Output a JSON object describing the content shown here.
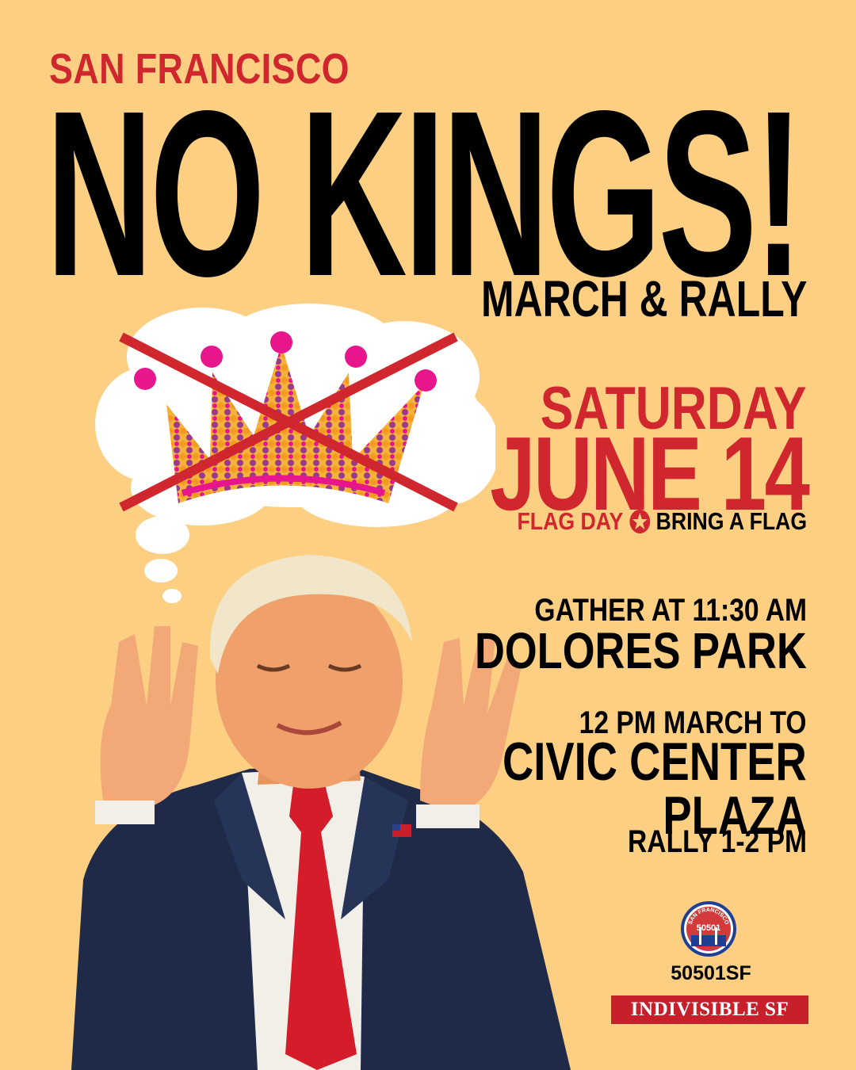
{
  "header": {
    "city": "SAN FRANCISCO",
    "headline": "NO KINGS!",
    "subhead": "MARCH & RALLY"
  },
  "date_block": {
    "day": "SATURDAY",
    "date": "JUNE 14",
    "flag_day": "FLAG DAY",
    "bring_flag": "BRING A FLAG"
  },
  "schedule": {
    "gather_time": "GATHER AT 11:30 AM",
    "gather_place": "DOLORES PARK",
    "march_time": "12 PM MARCH TO",
    "march_dest_line1": "CIVIC CENTER",
    "march_dest_line2": "PLAZA",
    "rally_time": "RALLY 1-2 PM"
  },
  "organizers": {
    "logo_top_text": "SAN FRANCISCO",
    "logo_number": "50501",
    "org_name": "50501SF",
    "badge": "INDIVISIBLE SF"
  },
  "icons": {
    "crown": "crown-icon",
    "cross": "cross-out-icon",
    "star": "star-icon",
    "logo": "50501-logo"
  },
  "colors": {
    "background": "#fccf83",
    "accent_red": "#d0262e",
    "crown_pink": "#e8168c",
    "crown_orange": "#f39a1e",
    "crown_purple": "#9b3a8c",
    "text": "#000000"
  }
}
